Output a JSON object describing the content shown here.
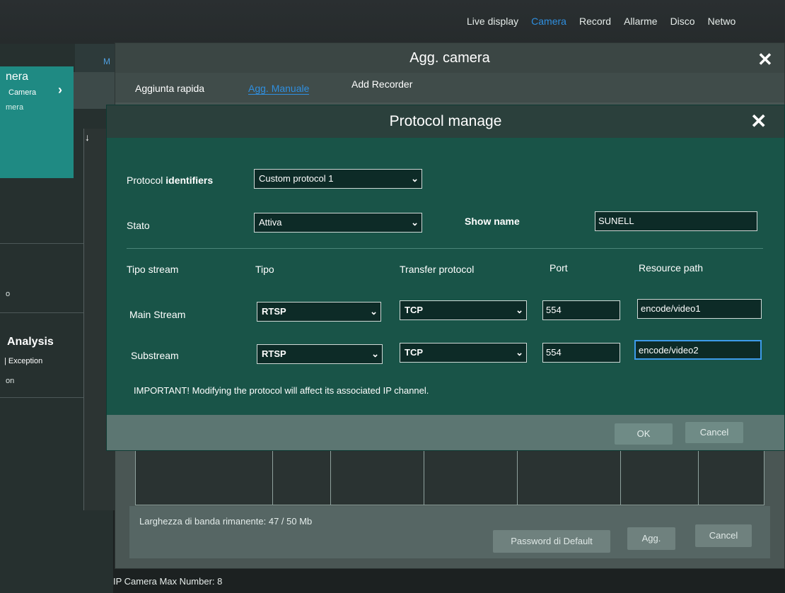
{
  "topnav": {
    "items": [
      "Live display",
      "Camera",
      "Record",
      "Allarme",
      "Disco",
      "Netwo"
    ],
    "active": "Camera"
  },
  "sidebar": {
    "camera_title": "nera",
    "camera_item": "Camera",
    "camera_sub": "mera",
    "o_label": "o",
    "analysis": "Analysis",
    "exception": "| Exception",
    "on_label": "on"
  },
  "background_tab": "M",
  "agg_dialog": {
    "title": "Agg. camera",
    "tabs": [
      "Aggiunta rapida",
      "Agg. Manuale",
      "Add Recorder"
    ],
    "bandwidth": "Larghezza di banda rimanente: 47 / 50 Mb",
    "buttons": [
      "Password di Default",
      "Agg.",
      "Cancel"
    ]
  },
  "max_number": "IP Camera Max Number: 8",
  "protocol_dialog": {
    "title": "Protocol manage",
    "protocol_identifiers_label_a": "Protocol ",
    "protocol_identifiers_label_b": "identifiers",
    "protocol_value": "Custom protocol 1",
    "stato_label": "Stato",
    "stato_value": "Attiva",
    "show_name_label": "Show name",
    "show_name_value": "SUNELL",
    "headers": {
      "tipo_stream": "Tipo stream",
      "tipo": "Tipo",
      "transfer": "Transfer protocol",
      "port": "Port",
      "resource": "Resource path"
    },
    "rows": [
      {
        "name": "Main Stream",
        "tipo": "RTSP",
        "transfer": "TCP",
        "port": "554",
        "path": "encode/video1"
      },
      {
        "name": "Substream",
        "tipo": "RTSP",
        "transfer": "TCP",
        "port": "554",
        "path": "encode/video2"
      }
    ],
    "warning": "IMPORTANT! Modifying the protocol will affect its associated IP channel.",
    "ok": "OK",
    "cancel": "Cancel"
  },
  "colors": {
    "accent_blue": "#2f8fe0",
    "dialog_green": "#195448",
    "sidebar_teal": "#1f8a83"
  }
}
